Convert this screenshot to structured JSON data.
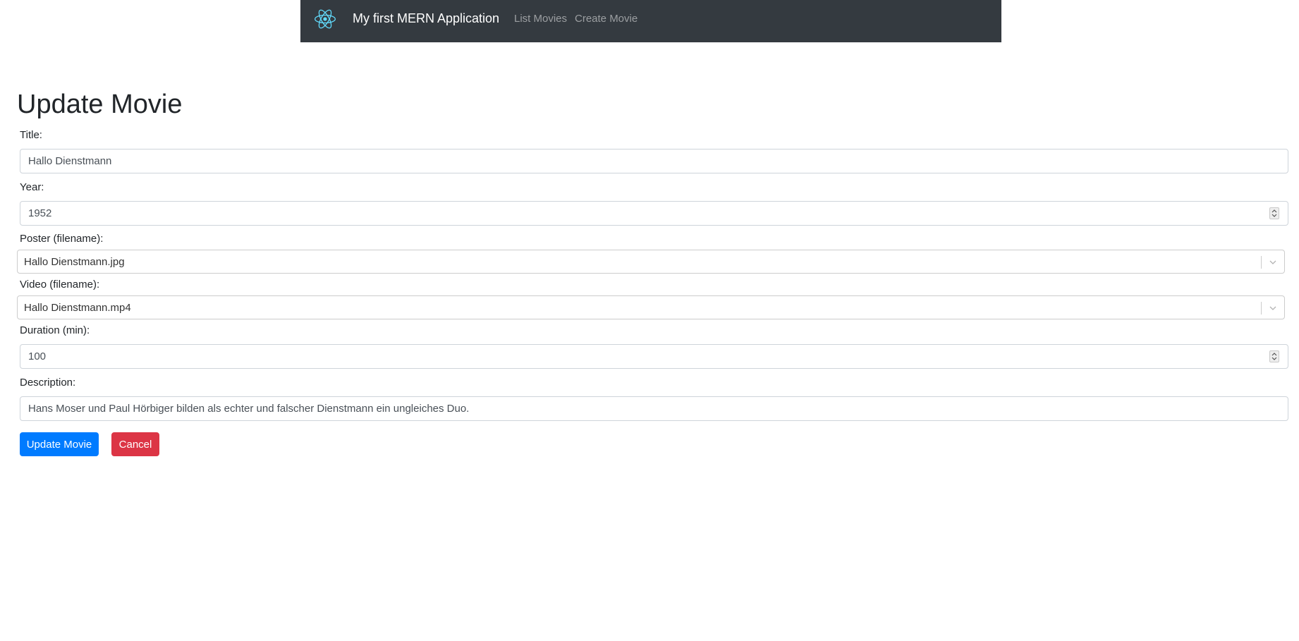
{
  "navbar": {
    "brand": "My first MERN Application",
    "links": [
      "List Movies",
      "Create Movie"
    ],
    "logo_icon": "react-logo-icon",
    "bg_color": "#343a40",
    "logo_color": "#61dafb"
  },
  "page": {
    "title": "Update Movie"
  },
  "form": {
    "title_label": "Title:",
    "title_value": "Hallo Dienstmann",
    "year_label": "Year:",
    "year_value": "1952",
    "poster_label": "Poster (filename):",
    "poster_value": "Hallo Dienstmann.jpg",
    "video_label": "Video (filename):",
    "video_value": "Hallo Dienstmann.mp4",
    "duration_label": "Duration (min):",
    "duration_value": "100",
    "description_label": "Description:",
    "description_value": "Hans Moser und Paul Hörbiger bilden als echter und falscher Dienstmann ein ungleiches Duo."
  },
  "buttons": {
    "update_label": "Update Movie",
    "cancel_label": "Cancel",
    "update_color": "#007bff",
    "cancel_color": "#dc3545"
  }
}
